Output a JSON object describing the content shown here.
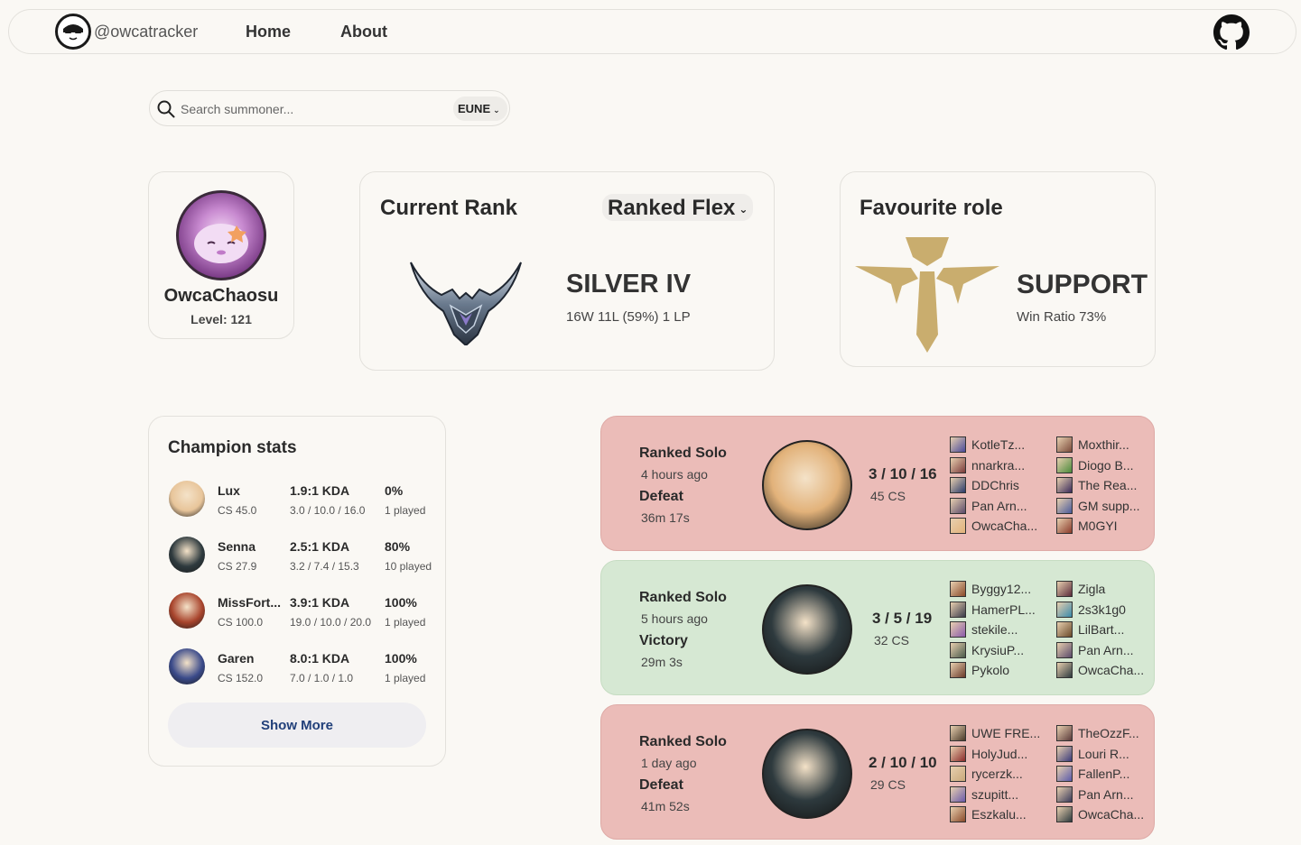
{
  "nav": {
    "handle": "@owcatracker",
    "links": [
      "Home",
      "About"
    ]
  },
  "search": {
    "placeholder": "Search summoner...",
    "region": "EUNE"
  },
  "profile": {
    "name": "OwcaChaosu",
    "level": "Level: 121"
  },
  "rank": {
    "title": "Current Rank",
    "queue": "Ranked Flex",
    "tier": "SILVER IV",
    "detail": "16W 11L (59%) 1 LP"
  },
  "role": {
    "title": "Favourite role",
    "name": "SUPPORT",
    "ratio": "Win Ratio 73%"
  },
  "champion_stats": {
    "title": "Champion stats",
    "rows": [
      {
        "name": "Lux",
        "cs": "CS 45.0",
        "kda": "1.9:1 KDA",
        "kda_detail": "3.0 / 10.0 / 16.0",
        "winrate": "0%",
        "played": "1 played",
        "color": "#e8c59a"
      },
      {
        "name": "Senna",
        "cs": "CS 27.9",
        "kda": "2.5:1 KDA",
        "kda_detail": "3.2 / 7.4 / 15.3",
        "winrate": "80%",
        "played": "10 played",
        "color": "#2e3a3e"
      },
      {
        "name": "MissFort...",
        "cs": "CS 100.0",
        "kda": "3.9:1 KDA",
        "kda_detail": "19.0 / 10.0 / 20.0",
        "winrate": "100%",
        "played": "1 played",
        "color": "#a8442c"
      },
      {
        "name": "Garen",
        "cs": "CS 152.0",
        "kda": "8.0:1 KDA",
        "kda_detail": "7.0 / 1.0 / 1.0",
        "winrate": "100%",
        "played": "1 played",
        "color": "#3a4a8a"
      }
    ],
    "show_more": "Show More"
  },
  "matches": [
    {
      "queue": "Ranked Solo",
      "ago": "4 hours ago",
      "result": "Defeat",
      "duration": "36m 17s",
      "kda": "3 / 10 / 16",
      "cs": "45 CS",
      "status": "defeat",
      "champ_color": "#e2b27a",
      "team1": [
        {
          "name": "KotleTz...",
          "color": "#4a4a9a"
        },
        {
          "name": "nnarkra...",
          "color": "#7a3a3a"
        },
        {
          "name": "DDChris",
          "color": "#2a3a6a"
        },
        {
          "name": "Pan Arn...",
          "color": "#5a4a6a"
        },
        {
          "name": "OwcaCha...",
          "color": "#e2b27a"
        }
      ],
      "team2": [
        {
          "name": "Moxthir...",
          "color": "#7a4a3a"
        },
        {
          "name": "Diogo B...",
          "color": "#4a8a3a"
        },
        {
          "name": "The Rea...",
          "color": "#3a2a5a"
        },
        {
          "name": "GM supp...",
          "color": "#4a5a9a"
        },
        {
          "name": "M0GYI",
          "color": "#8a3a2a"
        }
      ]
    },
    {
      "queue": "Ranked Solo",
      "ago": "5 hours ago",
      "result": "Victory",
      "duration": "29m 3s",
      "kda": "3 / 5 / 19",
      "cs": "32 CS",
      "status": "victory",
      "champ_color": "#2e3a3e",
      "team1": [
        {
          "name": "Byggy12...",
          "color": "#8a4a2a"
        },
        {
          "name": "HamerPL...",
          "color": "#3a3a4a"
        },
        {
          "name": "stekile...",
          "color": "#8a5aaa"
        },
        {
          "name": "KrysiuP...",
          "color": "#4a5a4a"
        },
        {
          "name": "Pykolo",
          "color": "#6a3a2a"
        }
      ],
      "team2": [
        {
          "name": "Zigla",
          "color": "#5a2a3a"
        },
        {
          "name": "2s3k1g0",
          "color": "#3a8aaa"
        },
        {
          "name": "LilBart...",
          "color": "#6a4a2a"
        },
        {
          "name": "Pan Arn...",
          "color": "#5a4a6a"
        },
        {
          "name": "OwcaCha...",
          "color": "#2e3a3e"
        }
      ]
    },
    {
      "queue": "Ranked Solo",
      "ago": "1 day ago",
      "result": "Defeat",
      "duration": "41m 52s",
      "kda": "2 / 10 / 10",
      "cs": "29 CS",
      "status": "defeat",
      "champ_color": "#2e3a3e",
      "team1": [
        {
          "name": "UWE FRE...",
          "color": "#4a3a2a"
        },
        {
          "name": "HolyJud...",
          "color": "#8a2a2a"
        },
        {
          "name": "rycerzk...",
          "color": "#c8a87a"
        },
        {
          "name": "szupitt...",
          "color": "#6a5aaa"
        },
        {
          "name": "Eszkalu...",
          "color": "#8a4a2a"
        }
      ],
      "team2": [
        {
          "name": "TheOzzF...",
          "color": "#5a3a3a"
        },
        {
          "name": "Louri R...",
          "color": "#3a3a7a"
        },
        {
          "name": "FallenP...",
          "color": "#5a5aaa"
        },
        {
          "name": "Pan Arn...",
          "color": "#3a3a5a"
        },
        {
          "name": "OwcaCha...",
          "color": "#2e3a3e"
        }
      ]
    }
  ]
}
